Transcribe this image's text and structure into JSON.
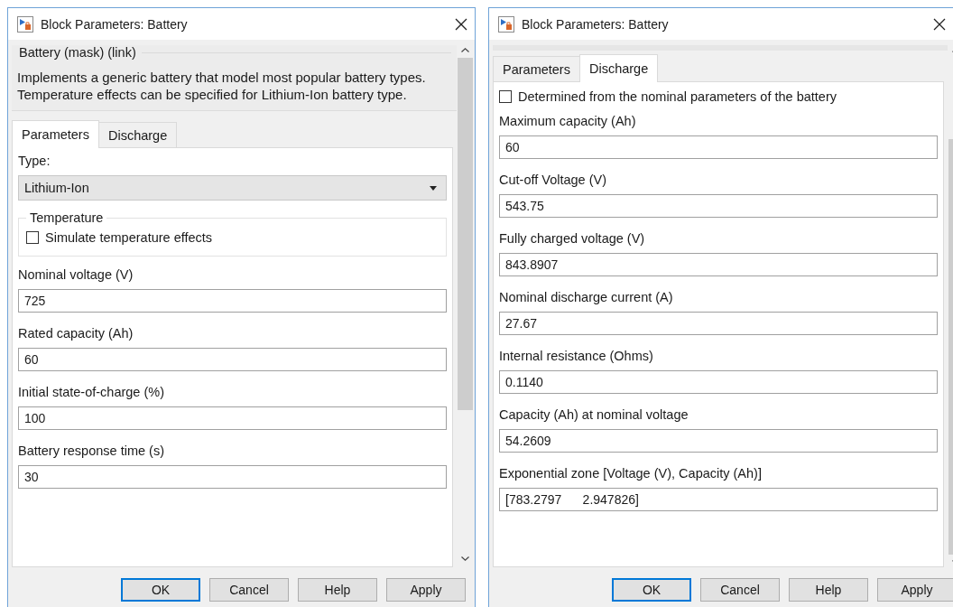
{
  "dialogs": [
    {
      "title": "Block Parameters: Battery",
      "header": {
        "title": "Battery (mask) (link)",
        "description": "Implements a generic battery that model most popular battery types. Temperature effects can be specified for Lithium-Ion battery type."
      },
      "tabs": [
        {
          "label": "Parameters",
          "selected": true
        },
        {
          "label": "Discharge",
          "selected": false
        }
      ],
      "fields": [
        {
          "kind": "dropdown",
          "label": "Type:",
          "value": "Lithium-Ion"
        },
        {
          "kind": "group",
          "title": "Temperature",
          "items": [
            {
              "label": "Simulate temperature effects",
              "checked": false
            }
          ]
        },
        {
          "kind": "text",
          "label": "Nominal voltage (V)",
          "value": "725"
        },
        {
          "kind": "text",
          "label": "Rated capacity (Ah)",
          "value": "60"
        },
        {
          "kind": "text",
          "label": "Initial state-of-charge (%)",
          "value": "100"
        },
        {
          "kind": "text",
          "label": "Battery response time (s)",
          "value": "30"
        }
      ],
      "buttons": [
        {
          "label": "OK",
          "default": true
        },
        {
          "label": "Cancel",
          "default": false
        },
        {
          "label": "Help",
          "default": false
        },
        {
          "label": "Apply",
          "default": false
        }
      ]
    },
    {
      "title": "Block Parameters: Battery",
      "tabs": [
        {
          "label": "Parameters",
          "selected": false
        },
        {
          "label": "Discharge",
          "selected": true
        }
      ],
      "fields": [
        {
          "kind": "checkbox",
          "label": "Determined from the nominal parameters of the battery",
          "checked": false
        },
        {
          "kind": "text",
          "label": "Maximum capacity (Ah)",
          "value": "60"
        },
        {
          "kind": "text",
          "label": "Cut-off Voltage (V)",
          "value": "543.75"
        },
        {
          "kind": "text",
          "label": "Fully charged voltage (V)",
          "value": "843.8907"
        },
        {
          "kind": "text",
          "label": "Nominal discharge current (A)",
          "value": "27.67"
        },
        {
          "kind": "text",
          "label": "Internal resistance (Ohms)",
          "value": "0.1140"
        },
        {
          "kind": "text",
          "label": "Capacity (Ah) at nominal voltage",
          "value": "54.2609"
        },
        {
          "kind": "text",
          "label": "Exponential zone [Voltage (V), Capacity (Ah)]",
          "value": "[783.2797      2.947826]"
        }
      ],
      "buttons": [
        {
          "label": "OK",
          "default": true
        },
        {
          "label": "Cancel",
          "default": false
        },
        {
          "label": "Help",
          "default": false
        },
        {
          "label": "Apply",
          "default": false
        }
      ]
    }
  ]
}
